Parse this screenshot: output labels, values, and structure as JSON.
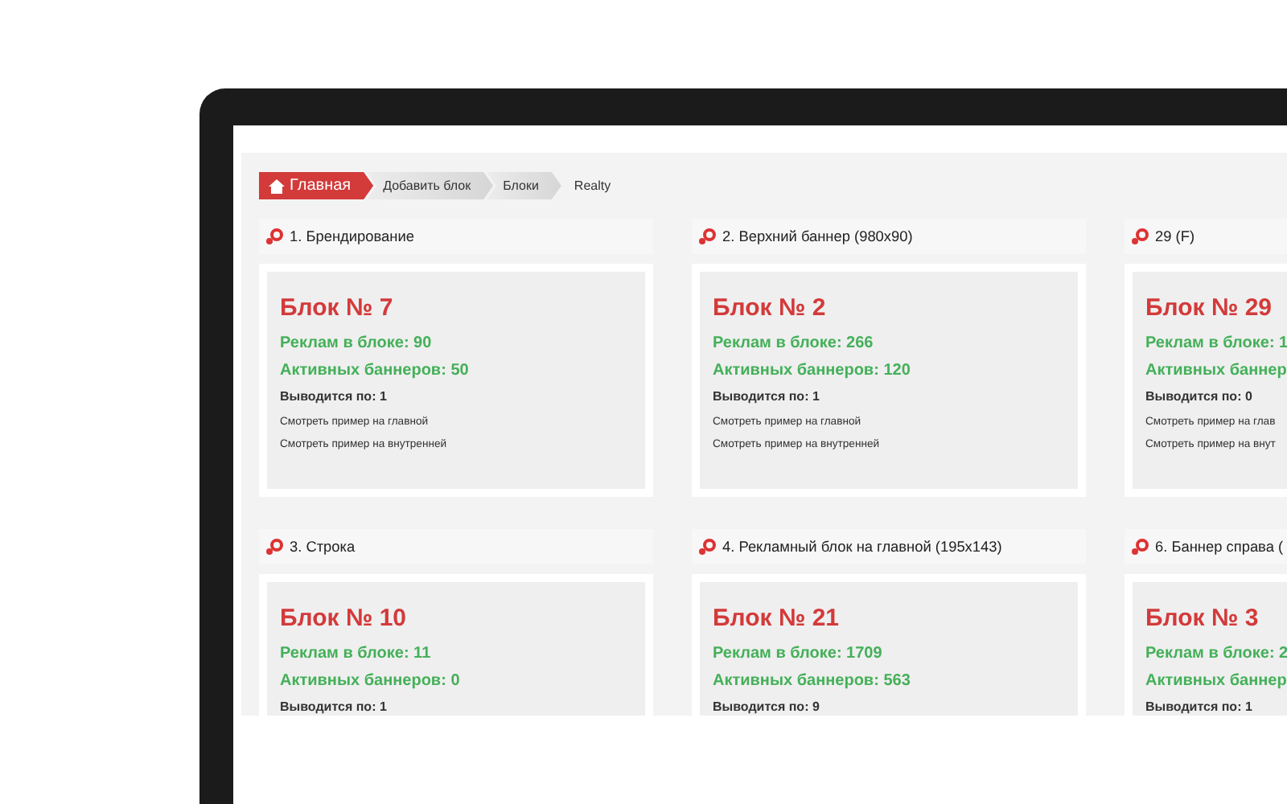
{
  "breadcrumb": [
    {
      "label": "Главная",
      "kind": "home"
    },
    {
      "label": "Добавить блок",
      "kind": "step"
    },
    {
      "label": "Блоки",
      "kind": "step"
    },
    {
      "label": "Realty",
      "kind": "plain"
    }
  ],
  "cards": [
    {
      "header": "1. Брендирование",
      "title": "Блок № 7",
      "ads": "Реклам в блоке: 90",
      "active": "Активных баннеров: 50",
      "shows": "Выводится по: 1",
      "links": [
        "Смотреть пример на главной",
        "Смотреть пример на внутренней"
      ]
    },
    {
      "header": "2. Верхний баннер (980x90)",
      "title": "Блок № 2",
      "ads": "Реклам в блоке: 266",
      "active": "Активных баннеров: 120",
      "shows": "Выводится по: 1",
      "links": [
        "Смотреть пример на главной",
        "Смотреть пример на внутренней"
      ]
    },
    {
      "header": "29 (F)",
      "title": "Блок № 29",
      "ads": "Реклам в блоке: 1",
      "active": "Активных баннер",
      "shows": "Выводится по: 0",
      "links": [
        "Смотреть пример на глав",
        "Смотреть пример на внут"
      ]
    },
    {
      "header": "3. Строка",
      "title": "Блок № 10",
      "ads": "Реклам в блоке: 11",
      "active": "Активных баннеров: 0",
      "shows": "Выводится по: 1"
    },
    {
      "header": "4. Рекламный блок на главной (195x143)",
      "title": "Блок № 21",
      "ads": "Реклам в блоке: 1709",
      "active": "Активных баннеров: 563",
      "shows": "Выводится по: 9"
    },
    {
      "header": "6. Баннер справа (",
      "title": "Блок № 3",
      "ads": "Реклам в блоке: 2",
      "active": "Активных баннер",
      "shows": "Выводится по: 1"
    }
  ]
}
